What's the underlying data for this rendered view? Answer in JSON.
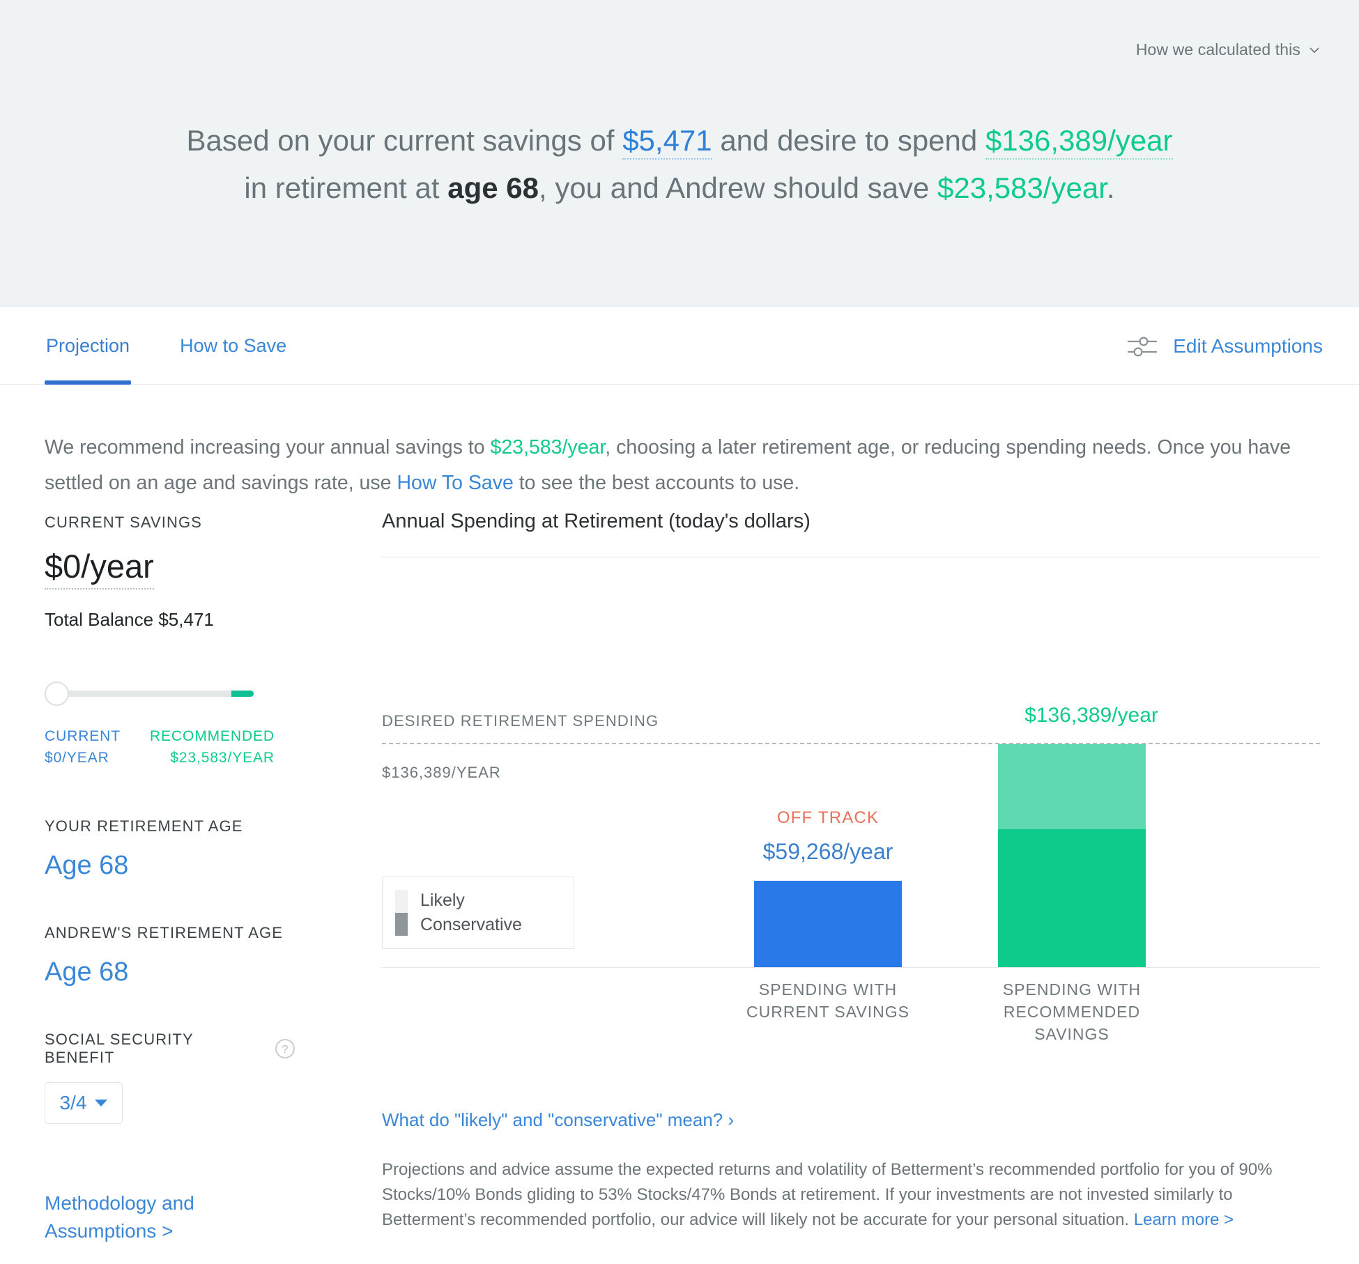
{
  "hero": {
    "how_calculated_label": "How we calculated this",
    "chevron_icon": "chevron-down-icon",
    "line1_a": "Based on your current savings of ",
    "current_savings": "$5,471",
    "line1_b": " and desire to spend ",
    "desired_spending": "$136,389/year",
    "line2_a": "in retirement at ",
    "retirement_age": "age 68",
    "line2_b": ", you and Andrew should save ",
    "recommended_savings": "$23,583/year",
    "line2_c": "."
  },
  "tabs": [
    {
      "label": "Projection",
      "active": true
    },
    {
      "label": "How to Save",
      "active": false
    }
  ],
  "edit_assumptions": {
    "label": "Edit Assumptions",
    "icon": "sliders-icon"
  },
  "recommendation": {
    "part1": "We recommend increasing your annual savings to ",
    "amount": "$23,583/year",
    "part2": ", choosing a later retirement age, or reducing spending needs. Once you have settled on an age and savings rate, use ",
    "link": "How To Save",
    "part3": " to see the best accounts to use."
  },
  "sidebar": {
    "current_savings_label": "CURRENT SAVINGS",
    "current_savings_value": "$0/year",
    "total_balance": "Total Balance $5,471",
    "slider": {
      "current_label": "CURRENT",
      "current_value": "$0/YEAR",
      "recommended_label": "RECOMMENDED",
      "recommended_value": "$23,583/YEAR",
      "handle_position_pct": 0,
      "fill_start_pct": 89
    },
    "your_age_label": "YOUR RETIREMENT AGE",
    "your_age_value": "Age 68",
    "partner_age_label": "ANDREW'S RETIREMENT AGE",
    "partner_age_value": "Age 68",
    "social_security_label": "SOCIAL SECURITY BENEFIT",
    "social_security_help_icon": "question-mark-circle-icon",
    "social_security_value": "3/4",
    "methodology_link": "Methodology and Assumptions >"
  },
  "chart_data": {
    "type": "bar",
    "title": "Annual Spending at Retirement (today's dollars)",
    "xlabel": "",
    "ylabel": "",
    "ylim": [
      0,
      136389
    ],
    "grid": false,
    "legend_position": "inside-left",
    "reference_line": {
      "label": "DESIRED RETIREMENT SPENDING",
      "value": 136389,
      "value_text": "$136,389/YEAR",
      "callout_text": "$136,389/year",
      "style": "dashed",
      "color": "#b4bbbf"
    },
    "categories": [
      "SPENDING WITH CURRENT SAVINGS",
      "SPENDING WITH RECOMMENDED SAVINGS"
    ],
    "series": [
      {
        "name": "Conservative",
        "values": [
          59268,
          96000
        ],
        "colors": [
          "#2979e8",
          "#0ecb8b"
        ]
      },
      {
        "name": "Likely",
        "values": [
          0,
          136389
        ],
        "colors": [
          "#2979e8",
          "#5fd9b2"
        ]
      }
    ],
    "bars": [
      {
        "category": "SPENDING WITH CURRENT SAVINGS",
        "value": 59268,
        "value_label": "$59,268/year",
        "status": "OFF TRACK",
        "status_color": "#e8705a",
        "color": "#2979e8",
        "label_line1": "SPENDING WITH",
        "label_line2": "CURRENT SAVINGS"
      },
      {
        "category": "SPENDING WITH RECOMMENDED SAVINGS",
        "value": 136389,
        "value_label": "$136,389/year",
        "status": "",
        "status_color": "",
        "color_likely": "#5fd9b2",
        "color_conservative": "#0ecb8b",
        "label_line1": "SPENDING WITH",
        "label_line2": "RECOMMENDED SAVINGS"
      }
    ],
    "legend": [
      {
        "label": "Likely",
        "color": "#f0f1f2"
      },
      {
        "label": "Conservative",
        "color": "#8f969a"
      }
    ]
  },
  "chart_footer": {
    "meaning_link": "What do \"likely\" and \"conservative\" mean? ›",
    "disclaimer": "Projections and advice assume the expected returns and volatility of Betterment’s recommended portfolio for you of 90% Stocks/10% Bonds gliding to 53% Stocks/47% Bonds at retirement. If your investments are not invested similarly to Betterment’s recommended portfolio, our advice will likely not be accurate for your personal situation. ",
    "learn_more": "Learn more >"
  }
}
